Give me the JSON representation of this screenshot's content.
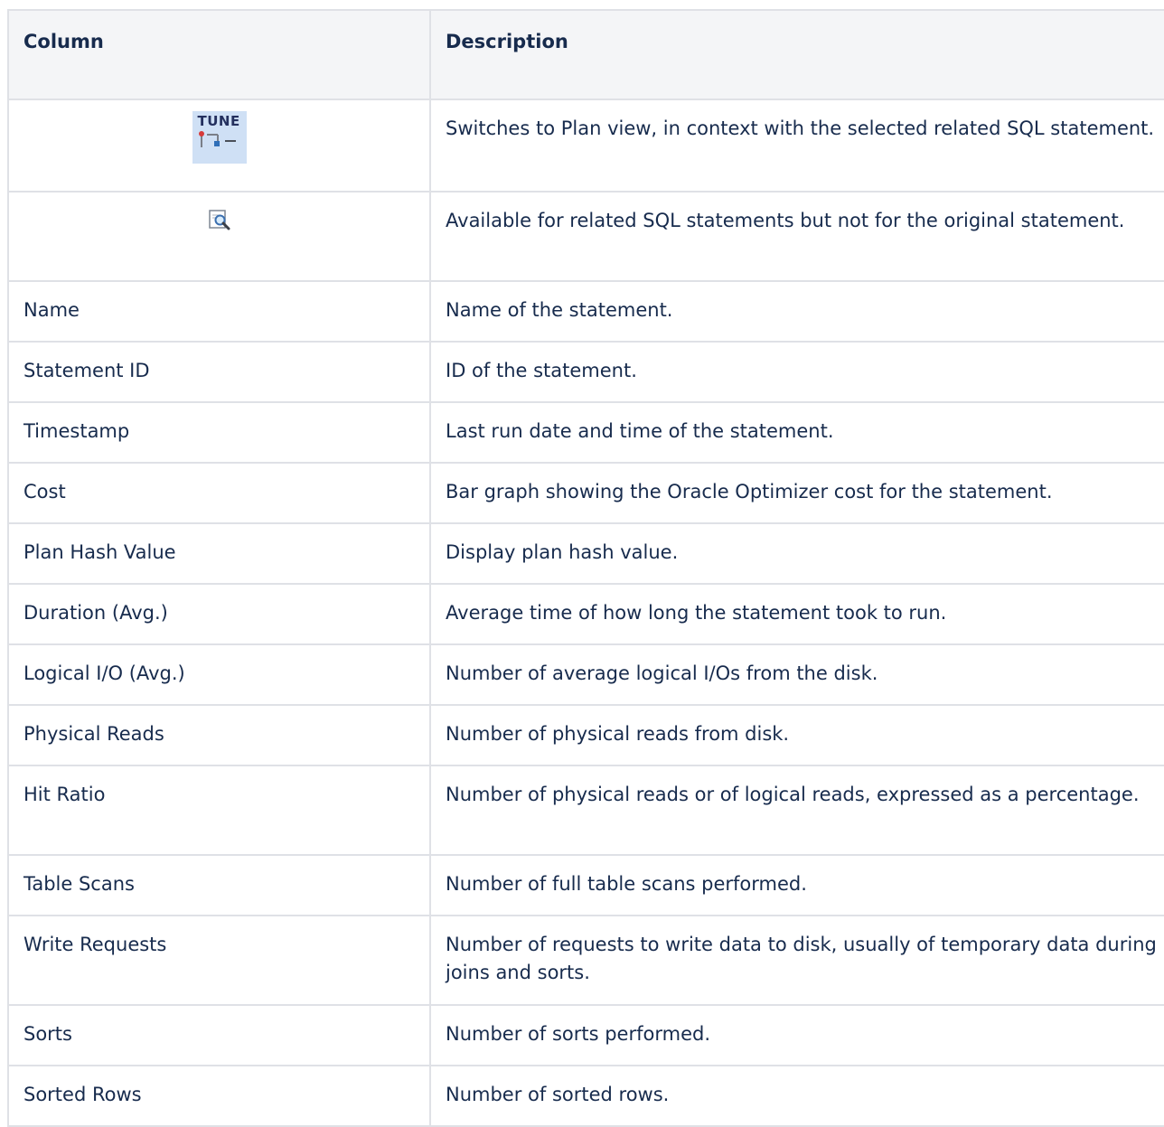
{
  "table": {
    "headers": {
      "column": "Column",
      "description": "Description"
    },
    "icon_rows": [
      {
        "icon": "tune-icon",
        "icon_text": "TUNE",
        "description": "Switches to Plan view, in context with the selected related SQL statement."
      },
      {
        "icon": "magnify-document-icon",
        "description": "Available for related SQL statements but not for the original statement."
      }
    ],
    "rows": [
      {
        "column": "Name",
        "description": "Name of the statement."
      },
      {
        "column": "Statement ID",
        "description": "ID of the statement."
      },
      {
        "column": "Timestamp",
        "description": "Last run date and time of the statement."
      },
      {
        "column": "Cost",
        "description": "Bar graph showing the Oracle Optimizer cost for the statement."
      },
      {
        "column": "Plan Hash Value",
        "description": "Display plan hash value."
      },
      {
        "column": "Duration (Avg.)",
        "description": "Average time of how long the statement took to run."
      },
      {
        "column": "Logical I/O (Avg.)",
        "description": "Number of average logical I/Os from the disk."
      },
      {
        "column": "Physical Reads",
        "description": "Number of physical reads from disk."
      },
      {
        "column": "Hit Ratio",
        "description": "Number of physical reads or of logical reads, expressed as a percentage."
      },
      {
        "column": "Table Scans",
        "description": "Number of full table scans performed."
      },
      {
        "column": "Write Requests",
        "description": "Number of requests to write data to disk, usually of temporary data during joins and sorts."
      },
      {
        "column": "Sorts",
        "description": "Number of sorts performed."
      },
      {
        "column": "Sorted Rows",
        "description": "Number of sorted rows."
      }
    ]
  }
}
